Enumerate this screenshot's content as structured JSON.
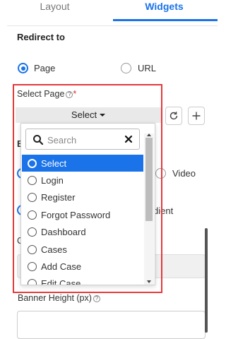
{
  "tabs": [
    {
      "label": "Layout"
    },
    {
      "label": "Widgets"
    }
  ],
  "redirect": {
    "title": "Redirect to",
    "options": [
      {
        "label": "Page",
        "selected": true
      },
      {
        "label": "URL",
        "selected": false
      }
    ]
  },
  "select_page": {
    "label": "Select Page",
    "required_mark": "*",
    "value": "Select"
  },
  "dropdown": {
    "search_placeholder": "Search",
    "options": [
      "Select",
      "Login",
      "Register",
      "Forgot Password",
      "Dashboard",
      "Cases",
      "Add Case",
      "Edit Case"
    ],
    "selected": "Select"
  },
  "background": {
    "partial_heading": "B",
    "video_label": "Video",
    "gradient_partial": "dient",
    "partial_label": "C"
  },
  "banner_height": {
    "label": "Banner Height (px)"
  },
  "colors": {
    "accent": "#1a73e8",
    "highlight": "#e5393b"
  }
}
